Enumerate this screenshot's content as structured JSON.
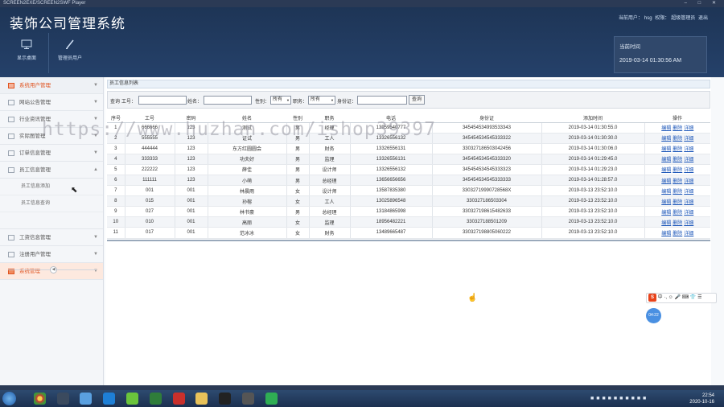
{
  "window": {
    "title": "SCREEN2EXE/SCREEN2SWF Player"
  },
  "header": {
    "app_title": "装饰公司管理系统",
    "user_label": "当前用户：",
    "user_name": "hsg",
    "role_label": "权限：",
    "role_name": "超级管理员",
    "logout": "退出",
    "toolbar": [
      {
        "label": "显示桌面",
        "icon": "monitor-icon"
      },
      {
        "label": "管理员用户",
        "icon": "pencil-icon"
      }
    ],
    "time_label": "当前时间",
    "time_value": "2019-03-14 01:30:56 AM"
  },
  "sidebar": {
    "items": [
      {
        "label": "系统用户管理",
        "active": true
      },
      {
        "label": "网站公告管理"
      },
      {
        "label": "行业资讯管理"
      },
      {
        "label": "实际图管理"
      },
      {
        "label": "订单信息管理"
      },
      {
        "label": "员工信息管理",
        "expanded": true
      }
    ],
    "submenu": [
      {
        "label": "员工信息添加"
      },
      {
        "label": "员工信息查询"
      }
    ],
    "items_after": [
      {
        "label": "工资信息管理"
      },
      {
        "label": "注册用户管理"
      },
      {
        "label": "系统管理",
        "active_bottom": true
      }
    ]
  },
  "panel": {
    "title": "员工信息列表"
  },
  "search": {
    "query_label": "查询",
    "id_label": "工号：",
    "name_label": "姓名：",
    "gender_label": "性别：",
    "gender_value": "所有",
    "position_label": "职务：",
    "position_value": "所有",
    "idcard_label": "身份证：",
    "button": "查询"
  },
  "table": {
    "headers": [
      "序号",
      "工号",
      "密码",
      "姓名",
      "性别",
      "职务",
      "电话",
      "身份证",
      "添加时间",
      "操作"
    ],
    "ops": [
      "编辑",
      "删除",
      "详细"
    ],
    "rows": [
      [
        "1",
        "666666",
        "123",
        "测试",
        "男",
        "经理",
        "13959540777",
        "345454534993533343",
        "2019-03-14 01:30:55.0"
      ],
      [
        "2",
        "555555",
        "123",
        "证试",
        "男",
        "工人",
        "13326556132",
        "345454534545333322",
        "2019-03-14 01:30:30.0"
      ],
      [
        "3",
        "444444",
        "123",
        "东方红圆圆会",
        "男",
        "财务",
        "13326556131",
        "330327186503042456",
        "2019-03-14 01:30:06.0"
      ],
      [
        "4",
        "333333",
        "123",
        "功夫好",
        "男",
        "监理",
        "13326556131",
        "345454534545333320",
        "2019-03-14 01:29:45.0"
      ],
      [
        "5",
        "222222",
        "123",
        "薛佳",
        "男",
        "设计师",
        "13326556132",
        "345454534545333323",
        "2019-03-14 01:29:23.0"
      ],
      [
        "6",
        "111111",
        "123",
        "小萌",
        "男",
        "总经理",
        "13656656656",
        "345454534545333333",
        "2019-03-14 01:28:57.0"
      ],
      [
        "7",
        "001",
        "001",
        "林晨雨",
        "女",
        "设计师",
        "13587835380",
        "33032719990728568X",
        "2019-03-13 23:52:10.0"
      ],
      [
        "8",
        "015",
        "001",
        "孙榕",
        "女",
        "工人",
        "13025896548",
        "330327186503304",
        "2019-03-13 23:52:10.0"
      ],
      [
        "9",
        "027",
        "001",
        "林书豪",
        "男",
        "总经理",
        "13184865998",
        "330327198615482633",
        "2019-03-13 23:52:10.0"
      ],
      [
        "10",
        "010",
        "001",
        "高丽",
        "女",
        "监理",
        "18956482221",
        "330327188501209",
        "2019-03-13 23:52:10.0"
      ],
      [
        "11",
        "017",
        "001",
        "范冰冰",
        "女",
        "财务",
        "13489665487",
        "330327198805060222",
        "2019-03-13 23:52:10.0"
      ]
    ]
  },
  "watermark": "https://www.huzhan.com/ishop39397",
  "ime": {
    "logo": "S",
    "text": "中 ·, ☺ 🎤 ⌨ 👕 ☰"
  },
  "bubble": "04:22",
  "taskbar": {
    "time": "22:54",
    "date": "2020-10-16"
  }
}
